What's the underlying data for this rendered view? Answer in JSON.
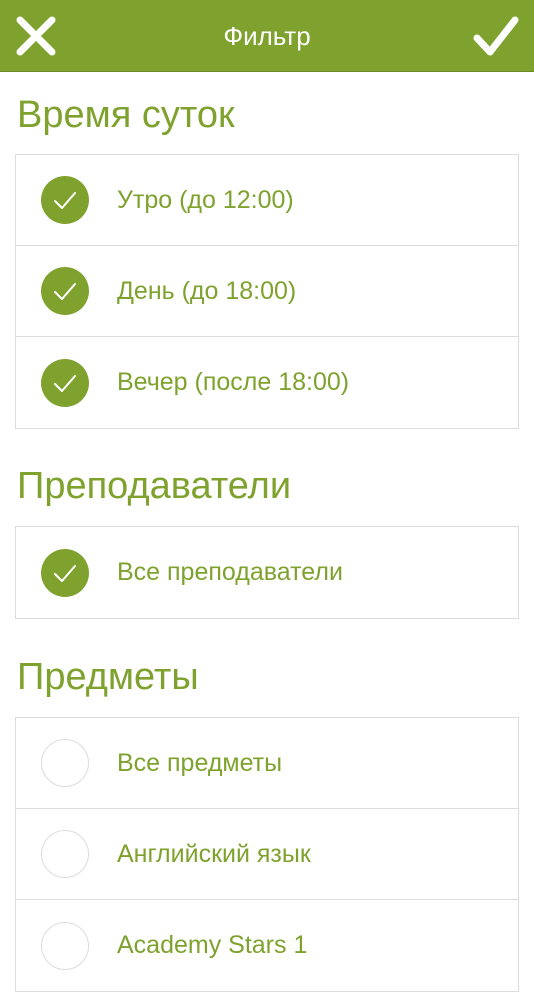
{
  "header": {
    "title": "Фильтр",
    "bg_color": "#7fa22e",
    "close_icon": "close-icon",
    "confirm_icon": "checkmark-icon"
  },
  "sections": {
    "time_of_day": {
      "title": "Время суток",
      "items": [
        {
          "label": "Утро (до 12:00)",
          "checked": true
        },
        {
          "label": "День (до 18:00)",
          "checked": true
        },
        {
          "label": "Вечер (после 18:00)",
          "checked": true
        }
      ]
    },
    "teachers": {
      "title": "Преподаватели",
      "items": [
        {
          "label": "Все преподаватели",
          "checked": true
        }
      ]
    },
    "subjects": {
      "title": "Предметы",
      "items": [
        {
          "label": "Все предметы",
          "checked": false
        },
        {
          "label": "Английский язык",
          "checked": false
        },
        {
          "label": "Academy Stars 1",
          "checked": false
        }
      ]
    }
  },
  "colors": {
    "accent": "#7fa22e",
    "border": "#dcdcdc"
  }
}
